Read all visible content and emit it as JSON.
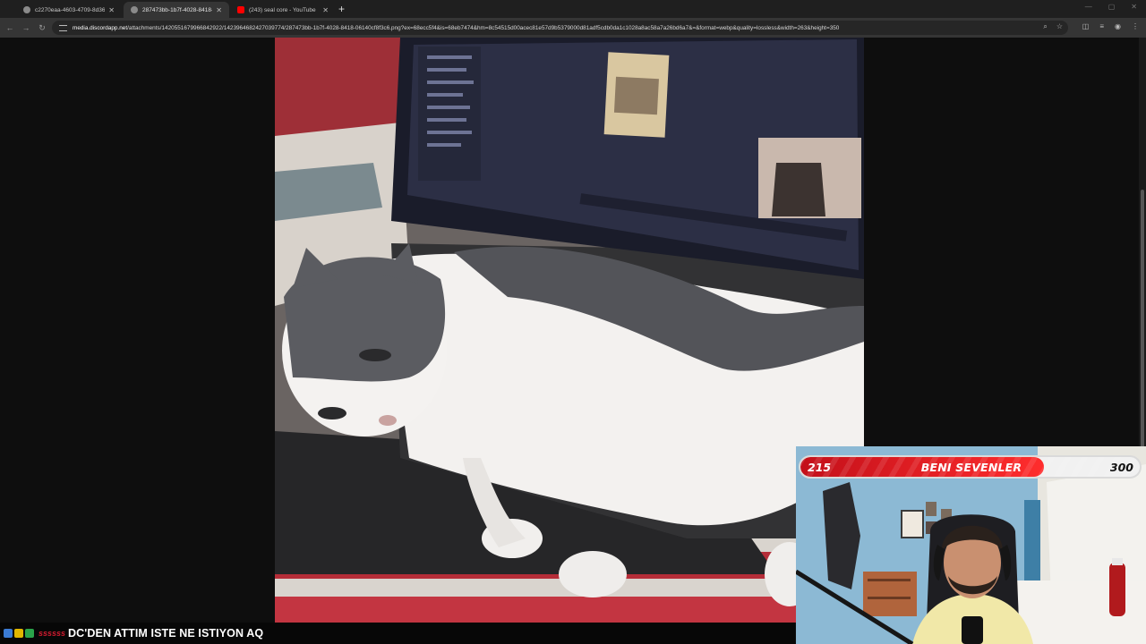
{
  "browser": {
    "tabs": [
      {
        "title": "c2270eaa-4603-4709-8d36-03f",
        "active": false,
        "favicon": "globe-icon"
      },
      {
        "title": "287473bb-1b7f-4028-8418-06",
        "active": true,
        "favicon": "globe-icon"
      },
      {
        "title": "(243) seal core - YouTube",
        "active": false,
        "favicon": "youtube-icon"
      }
    ],
    "url_host": "media.discordapp.net",
    "url_path": "/attachments/1420551679966842922/1423964682427039774/287473bb-1b7f-4028-8418-06140cf8f3c6.png?ex=68ecc5f4&is=68eb7474&hm=8c54515d00acec81e57d9b5379000d81adf5cdb0da1c1028a8ac58a7a26bd6a7&=&format=webp&quality=lossless&width=263&height=350"
  },
  "follower_goal": {
    "current": "215",
    "label": "BENI SEVENLER",
    "goal": "300",
    "progress": 0.717
  },
  "ticker": {
    "username": "ssssss",
    "message": "DC'DEN ATTIM ISTE NE ISTIYON AQ"
  },
  "colors": {
    "accent": "#e8161e",
    "bar_bg": "#f1f1f1"
  }
}
